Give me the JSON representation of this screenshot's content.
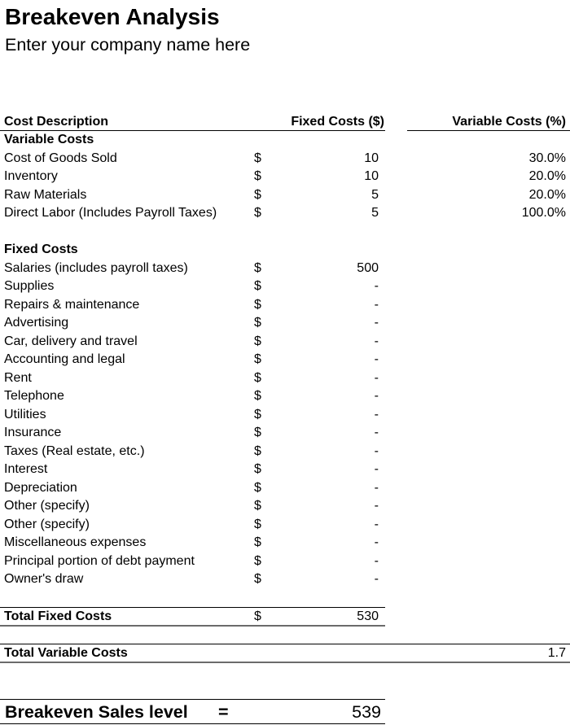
{
  "header": {
    "title": "Breakeven Analysis",
    "subtitle": "Enter your company name here"
  },
  "columns": {
    "description": "Cost Description",
    "fixed": "Fixed Costs ($)",
    "variable": "Variable Costs (%)"
  },
  "variable_costs": {
    "section_label": "Variable Costs",
    "items": [
      {
        "label": "Cost of Goods Sold",
        "currency": "$",
        "fixed": "10",
        "variable": "30.0%"
      },
      {
        "label": "Inventory",
        "currency": "$",
        "fixed": "10",
        "variable": "20.0%"
      },
      {
        "label": "Raw Materials",
        "currency": "$",
        "fixed": "5",
        "variable": "20.0%"
      },
      {
        "label": "Direct Labor (Includes Payroll Taxes)",
        "currency": "$",
        "fixed": "5",
        "variable": "100.0%"
      }
    ]
  },
  "fixed_costs": {
    "section_label": "Fixed Costs",
    "items": [
      {
        "label": "Salaries (includes payroll taxes)",
        "currency": "$",
        "fixed": "500"
      },
      {
        "label": "Supplies",
        "currency": "$",
        "fixed": "-"
      },
      {
        "label": "Repairs & maintenance",
        "currency": "$",
        "fixed": "-"
      },
      {
        "label": "Advertising",
        "currency": "$",
        "fixed": "-"
      },
      {
        "label": "Car, delivery and travel",
        "currency": "$",
        "fixed": "-"
      },
      {
        "label": "Accounting and legal",
        "currency": "$",
        "fixed": "-"
      },
      {
        "label": "Rent",
        "currency": "$",
        "fixed": "-"
      },
      {
        "label": "Telephone",
        "currency": "$",
        "fixed": "-"
      },
      {
        "label": "Utilities",
        "currency": "$",
        "fixed": "-"
      },
      {
        "label": "Insurance",
        "currency": "$",
        "fixed": "-"
      },
      {
        "label": "Taxes (Real estate, etc.)",
        "currency": "$",
        "fixed": "-"
      },
      {
        "label": "Interest",
        "currency": "$",
        "fixed": "-"
      },
      {
        "label": "Depreciation",
        "currency": "$",
        "fixed": "-"
      },
      {
        "label": "Other (specify)",
        "currency": "$",
        "fixed": "-"
      },
      {
        "label": "Other (specify)",
        "currency": "$",
        "fixed": "-"
      },
      {
        "label": "Miscellaneous expenses",
        "currency": "$",
        "fixed": "-"
      },
      {
        "label": "Principal portion of debt payment",
        "currency": "$",
        "fixed": "-"
      },
      {
        "label": "Owner's draw",
        "currency": "$",
        "fixed": "-"
      }
    ]
  },
  "totals": {
    "fixed_label": "Total Fixed Costs",
    "fixed_currency": "$",
    "fixed_value": "530",
    "variable_label": "Total Variable Costs",
    "variable_value": "1.7"
  },
  "breakeven": {
    "label": "Breakeven Sales level",
    "equals": "=",
    "value": "539"
  }
}
